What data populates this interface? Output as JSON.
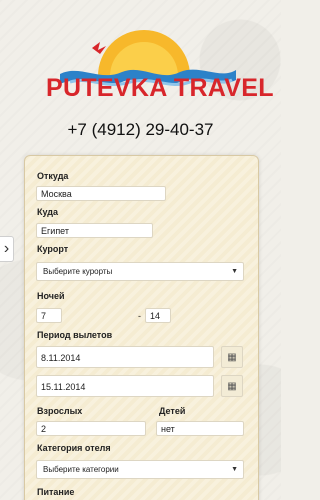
{
  "brand": {
    "name": "PUTEVKA TRAVEL"
  },
  "header": {
    "phone": "+7 (4912) 29-40-37"
  },
  "form": {
    "from": {
      "label": "Откуда",
      "value": "Москва"
    },
    "to": {
      "label": "Куда",
      "value": "Египет"
    },
    "resort": {
      "label": "Курорт",
      "value": "Выберите курорты"
    },
    "nights": {
      "label": "Ночей",
      "from": "7",
      "separator": "-",
      "to": "14"
    },
    "period": {
      "label": "Период вылетов",
      "start": "8.11.2014",
      "end": "15.11.2014"
    },
    "adults": {
      "label": "Взрослых",
      "value": "2"
    },
    "children": {
      "label": "Детей",
      "value": "нет"
    },
    "hotel_category": {
      "label": "Категория отеля",
      "value": "Выберите категории"
    },
    "meals": {
      "label": "Питание"
    }
  },
  "icons": {
    "calendar": "calendar-icon",
    "dropdown": "chevron-down-icon",
    "side": "chevron-right-icon"
  },
  "colors": {
    "brand_red": "#d8262b",
    "sun": "#f7b82b",
    "wave": "#2c82c9",
    "form_bg": "#f5ecd2"
  }
}
